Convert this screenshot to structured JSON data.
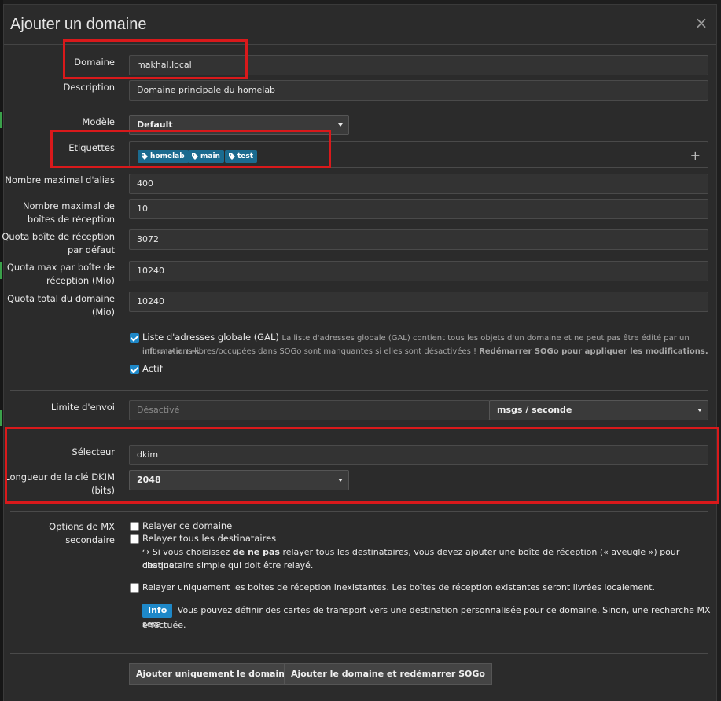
{
  "modal": {
    "title": "Ajouter un domaine",
    "close_symbol": "×"
  },
  "form": {
    "domain": {
      "label": "Domaine",
      "value": "makhal.local"
    },
    "description": {
      "label": "Description",
      "value": "Domaine principale du homelab"
    },
    "template": {
      "label": "Modèle",
      "selected": "Default"
    },
    "tags": {
      "label": "Etiquettes",
      "items": [
        "homelab",
        "main",
        "test"
      ],
      "add_symbol": "+"
    },
    "max_aliases": {
      "label": "Nombre maximal d'alias",
      "value": "400"
    },
    "max_mailboxes": {
      "label_line1": "Nombre maximal de",
      "label_line2": "boîtes de réception",
      "value": "10"
    },
    "default_quota": {
      "label_line1": "Quota boîte de réception",
      "label_line2": "par défaut",
      "value": "3072"
    },
    "max_quota": {
      "label_line1": "Quota max par boîte de",
      "label_line2": "réception (Mio)",
      "value": "10240"
    },
    "total_quota": {
      "label_line1": "Quota total du domaine",
      "label_line2": "(Mio)",
      "value": "10240"
    },
    "gal": {
      "label": "Liste d'adresses globale (GAL)",
      "help_line1": "La liste d'adresses globale (GAL) contient tous les objets d'un domaine et ne peut pas être édité par un utilisateur. Les",
      "help_line2": "informations libres/occupées dans SOGo sont manquantes si elles sont désactivées !",
      "help_strong": "Redémarrer SOGo pour appliquer les modifications.",
      "checked": true
    },
    "active": {
      "label": "Actif",
      "checked": true
    },
    "rate_limit": {
      "label": "Limite d'envoi",
      "placeholder": "Désactivé",
      "unit": "msgs / seconde"
    },
    "dkim_selector": {
      "label": "Sélecteur",
      "value": "dkim"
    },
    "dkim_length": {
      "label_line1": "Longueur de la clé DKIM",
      "label_line2": "(bits)",
      "selected": "2048"
    },
    "mx": {
      "label_line1": "Options de MX",
      "label_line2": "secondaire",
      "relay_domain": "Relayer ce domaine",
      "relay_all": "Relayer tous les destinataires",
      "note_prefix": "Si vous choisissez",
      "note_strong": "de ne pas",
      "note_rest": "relayer tous les destinataires, vous devez ajouter une boîte de réception (« aveugle ») pour chaque",
      "note_line2": "destinataire simple qui doit être relayé.",
      "relay_unknown": "Relayer uniquement les boîtes de réception inexistantes. Les boîtes de réception existantes seront livrées localement.",
      "info_badge": "Info",
      "info_line1": "Vous pouvez définir des cartes de transport vers une destination personnalisée pour ce domaine. Sinon, une recherche MX sera",
      "info_line2": "effectuée."
    }
  },
  "buttons": {
    "add_only": "Ajouter uniquement le domaine",
    "add_restart": "Ajouter le domaine et redémarrer SOGo"
  },
  "colors": {
    "highlight": "#d9191b",
    "accent": "#1e88c8",
    "tag": "#1b6b8f",
    "modal_bg": "#2b2b2b"
  }
}
